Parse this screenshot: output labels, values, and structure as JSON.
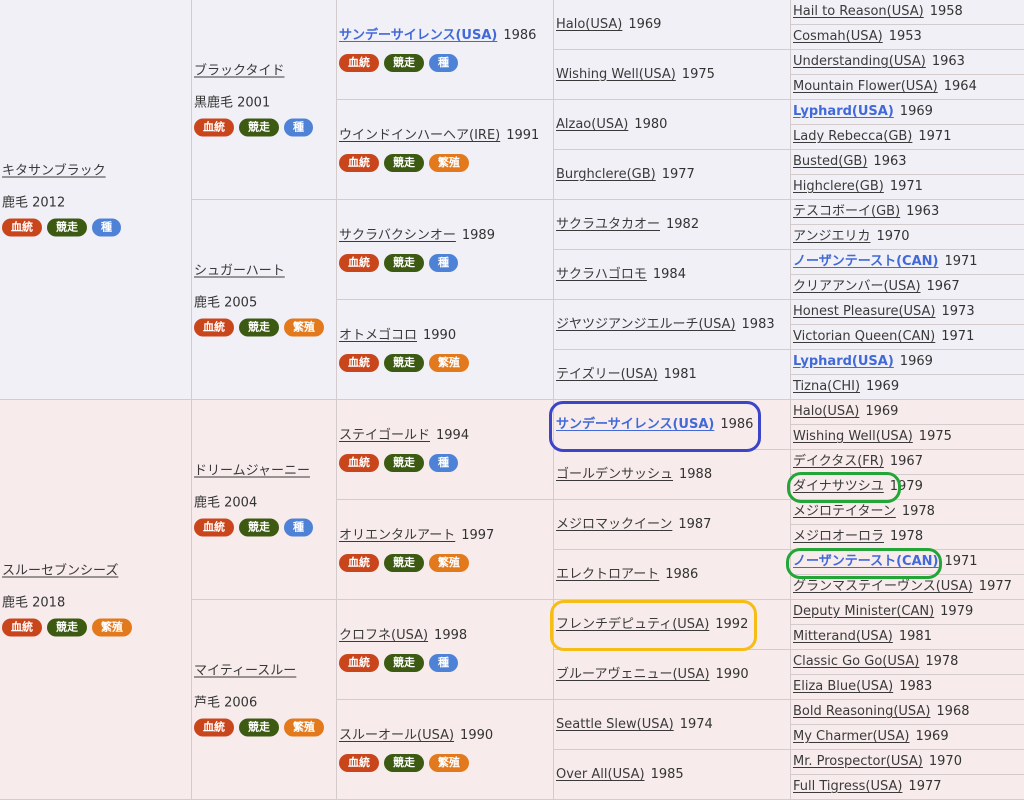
{
  "badges": {
    "ketto": "血統",
    "kyoso": "競走",
    "tane": "種",
    "hanshoku": "繁殖"
  },
  "colors": {
    "sire_bg": "#f1f0f6",
    "dam_bg": "#f7eceb",
    "link_bold": "#4169d8",
    "badge_ketto": "#c9461d",
    "badge_kyoso": "#3c5a12",
    "badge_tane": "#4e82d6",
    "badge_hanshoku": "#e3791d",
    "highlight_blue": "#3c44c8",
    "highlight_green": "#23a637",
    "highlight_yellow": "#f5bd16"
  },
  "gen1": [
    {
      "name": "キタサンブラック",
      "coat": "鹿毛 2012",
      "badges": [
        "ketto",
        "kyoso",
        "tane"
      ]
    },
    {
      "name": "スルーセブンシーズ",
      "coat": "鹿毛 2018",
      "badges": [
        "ketto",
        "kyoso",
        "hanshoku"
      ]
    }
  ],
  "gen2": [
    {
      "name": "ブラックタイド",
      "coat": "黒鹿毛 2001",
      "badges": [
        "ketto",
        "kyoso",
        "tane"
      ]
    },
    {
      "name": "シュガーハート",
      "coat": "鹿毛 2005",
      "badges": [
        "ketto",
        "kyoso",
        "hanshoku"
      ]
    },
    {
      "name": "ドリームジャーニー",
      "coat": "鹿毛 2004",
      "badges": [
        "ketto",
        "kyoso",
        "tane"
      ]
    },
    {
      "name": "マイティースルー",
      "coat": "芦毛 2006",
      "badges": [
        "ketto",
        "kyoso",
        "hanshoku"
      ]
    }
  ],
  "gen3": [
    {
      "name": "サンデーサイレンス(USA)",
      "year": "1986",
      "bold": true,
      "badges": [
        "ketto",
        "kyoso",
        "tane"
      ]
    },
    {
      "name": "ウインドインハーヘア(IRE)",
      "year": "1991",
      "bold": false,
      "badges": [
        "ketto",
        "kyoso",
        "hanshoku"
      ]
    },
    {
      "name": "サクラバクシンオー",
      "year": "1989",
      "bold": false,
      "badges": [
        "ketto",
        "kyoso",
        "tane"
      ]
    },
    {
      "name": "オトメゴコロ",
      "year": "1990",
      "bold": false,
      "badges": [
        "ketto",
        "kyoso",
        "hanshoku"
      ]
    },
    {
      "name": "ステイゴールド",
      "year": "1994",
      "bold": false,
      "badges": [
        "ketto",
        "kyoso",
        "tane"
      ]
    },
    {
      "name": "オリエンタルアート",
      "year": "1997",
      "bold": false,
      "badges": [
        "ketto",
        "kyoso",
        "hanshoku"
      ]
    },
    {
      "name": "クロフネ(USA)",
      "year": "1998",
      "bold": false,
      "badges": [
        "ketto",
        "kyoso",
        "tane"
      ]
    },
    {
      "name": "スルーオール(USA)",
      "year": "1990",
      "bold": false,
      "badges": [
        "ketto",
        "kyoso",
        "hanshoku"
      ]
    }
  ],
  "gen4": [
    {
      "name": "Halo(USA)",
      "year": "1969",
      "bold": false
    },
    {
      "name": "Wishing Well(USA)",
      "year": "1975",
      "bold": false
    },
    {
      "name": "Alzao(USA)",
      "year": "1980",
      "bold": false
    },
    {
      "name": "Burghclere(GB)",
      "year": "1977",
      "bold": false
    },
    {
      "name": "サクラユタカオー",
      "year": "1982",
      "bold": false
    },
    {
      "name": "サクラハゴロモ",
      "year": "1984",
      "bold": false
    },
    {
      "name": "ジヤツジアンジエルーチ(USA)",
      "year": "1983",
      "bold": false
    },
    {
      "name": "テイズリー(USA)",
      "year": "1981",
      "bold": false
    },
    {
      "name": "サンデーサイレンス(USA)",
      "year": "1986",
      "bold": true
    },
    {
      "name": "ゴールデンサッシュ",
      "year": "1988",
      "bold": false
    },
    {
      "name": "メジロマックイーン",
      "year": "1987",
      "bold": false
    },
    {
      "name": "エレクトロアート",
      "year": "1986",
      "bold": false
    },
    {
      "name": "フレンチデピュティ(USA)",
      "year": "1992",
      "bold": false
    },
    {
      "name": "ブルーアヴェニュー(USA)",
      "year": "1990",
      "bold": false
    },
    {
      "name": "Seattle Slew(USA)",
      "year": "1974",
      "bold": false
    },
    {
      "name": "Over All(USA)",
      "year": "1985",
      "bold": false
    }
  ],
  "gen5": [
    {
      "name": "Hail to Reason(USA)",
      "year": "1958",
      "bold": false
    },
    {
      "name": "Cosmah(USA)",
      "year": "1953",
      "bold": false
    },
    {
      "name": "Understanding(USA)",
      "year": "1963",
      "bold": false
    },
    {
      "name": "Mountain Flower(USA)",
      "year": "1964",
      "bold": false
    },
    {
      "name": "Lyphard(USA)",
      "year": "1969",
      "bold": true
    },
    {
      "name": "Lady Rebecca(GB)",
      "year": "1971",
      "bold": false
    },
    {
      "name": "Busted(GB)",
      "year": "1963",
      "bold": false
    },
    {
      "name": "Highclere(GB)",
      "year": "1971",
      "bold": false
    },
    {
      "name": "テスコボーイ(GB)",
      "year": "1963",
      "bold": false
    },
    {
      "name": "アンジエリカ",
      "year": "1970",
      "bold": false
    },
    {
      "name": "ノーザンテースト(CAN)",
      "year": "1971",
      "bold": true
    },
    {
      "name": "クリアアンバー(USA)",
      "year": "1967",
      "bold": false
    },
    {
      "name": "Honest Pleasure(USA)",
      "year": "1973",
      "bold": false
    },
    {
      "name": "Victorian Queen(CAN)",
      "year": "1971",
      "bold": false
    },
    {
      "name": "Lyphard(USA)",
      "year": "1969",
      "bold": true
    },
    {
      "name": "Tizna(CHI)",
      "year": "1969",
      "bold": false
    },
    {
      "name": "Halo(USA)",
      "year": "1969",
      "bold": false
    },
    {
      "name": "Wishing Well(USA)",
      "year": "1975",
      "bold": false
    },
    {
      "name": "デイクタス(FR)",
      "year": "1967",
      "bold": false
    },
    {
      "name": "ダイナサツシユ",
      "year": "1979",
      "bold": false
    },
    {
      "name": "メジロテイターン",
      "year": "1978",
      "bold": false
    },
    {
      "name": "メジロオーロラ",
      "year": "1978",
      "bold": false
    },
    {
      "name": "ノーザンテースト(CAN)",
      "year": "1971",
      "bold": true
    },
    {
      "name": "グランマステイーヴンス(USA)",
      "year": "1977",
      "bold": false
    },
    {
      "name": "Deputy Minister(CAN)",
      "year": "1979",
      "bold": false
    },
    {
      "name": "Mitterand(USA)",
      "year": "1981",
      "bold": false
    },
    {
      "name": "Classic Go Go(USA)",
      "year": "1978",
      "bold": false
    },
    {
      "name": "Eliza Blue(USA)",
      "year": "1983",
      "bold": false
    },
    {
      "name": "Bold Reasoning(USA)",
      "year": "1968",
      "bold": false
    },
    {
      "name": "My Charmer(USA)",
      "year": "1969",
      "bold": false
    },
    {
      "name": "Mr. Prospector(USA)",
      "year": "1970",
      "bold": false
    },
    {
      "name": "Full Tigress(USA)",
      "year": "1977",
      "bold": false
    }
  ]
}
